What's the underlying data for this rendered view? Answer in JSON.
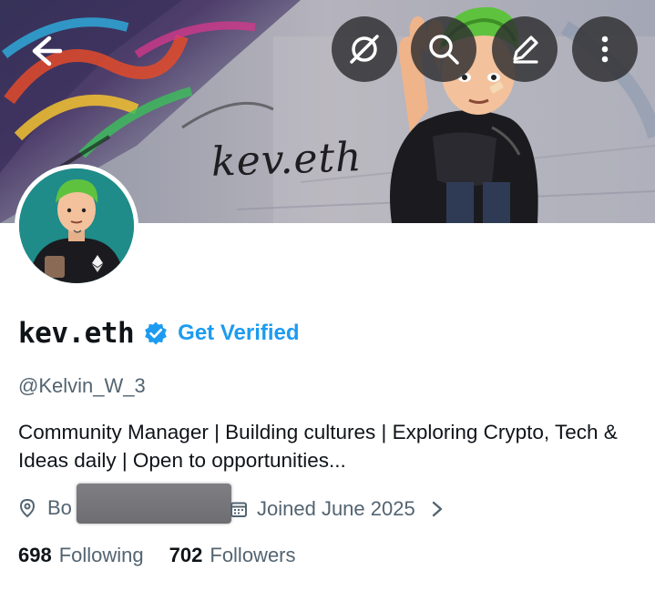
{
  "banner": {
    "tag_text": "kev.eth"
  },
  "toolbar": {
    "back_icon": "arrow-left-icon",
    "grok_icon": "grok-icon",
    "search_icon": "search-icon",
    "edit_icon": "pencil-icon",
    "more_icon": "more-vertical-icon"
  },
  "profile": {
    "display_name": "kev.eth",
    "verified_badge_color": "#1d9bf0",
    "get_verified_label": "Get Verified",
    "handle": "@Kelvin_W_3",
    "bio": "Community Manager | Building cultures | Exploring Crypto, Tech & Ideas daily | Open to opportunities...",
    "location_prefix": "Bo",
    "joined": "Joined June 2025",
    "following_count": "698",
    "following_label": "Following",
    "followers_count": "702",
    "followers_label": "Followers"
  },
  "colors": {
    "accent": "#1d9bf0",
    "secondary_text": "#536471",
    "primary_text": "#0f1419"
  }
}
